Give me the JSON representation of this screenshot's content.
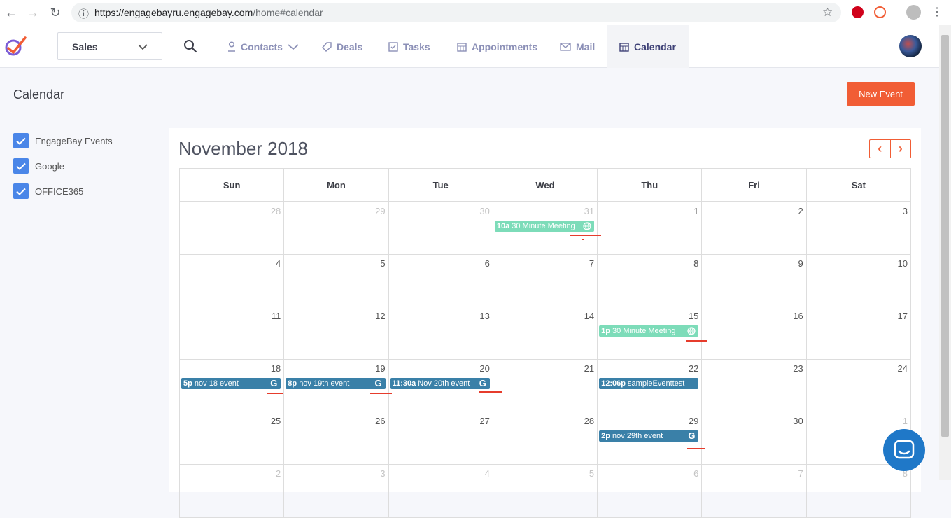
{
  "browser": {
    "url_host": "https://engagebayru.engagebay.com",
    "url_path": "/home#calendar"
  },
  "appnav": {
    "pipeline_select": "Sales",
    "items": [
      {
        "label": "Contacts"
      },
      {
        "label": "Deals"
      },
      {
        "label": "Tasks"
      },
      {
        "label": "Appointments"
      },
      {
        "label": "Mail"
      },
      {
        "label": "Calendar"
      }
    ]
  },
  "page": {
    "title": "Calendar",
    "new_event_label": "New Event"
  },
  "filters": [
    {
      "label": "EngageBay Events",
      "checked": true
    },
    {
      "label": "Google",
      "checked": true
    },
    {
      "label": "OFFICE365",
      "checked": true
    }
  ],
  "calendar": {
    "month_title": "November 2018",
    "prev_icon": "chevron-left-icon",
    "next_icon": "chevron-right-icon",
    "weekdays": [
      "Sun",
      "Mon",
      "Tue",
      "Wed",
      "Thu",
      "Fri",
      "Sat"
    ],
    "weeks": [
      [
        "28",
        "29",
        "30",
        "31",
        "1",
        "2",
        "3"
      ],
      [
        "4",
        "5",
        "6",
        "7",
        "8",
        "9",
        "10"
      ],
      [
        "11",
        "12",
        "13",
        "14",
        "15",
        "16",
        "17"
      ],
      [
        "18",
        "19",
        "20",
        "21",
        "22",
        "23",
        "24"
      ],
      [
        "25",
        "26",
        "27",
        "28",
        "29",
        "30",
        "1"
      ],
      [
        "2",
        "3",
        "4",
        "5",
        "6",
        "7",
        "8"
      ]
    ],
    "events": [
      {
        "time": "10a",
        "title": "30 Minute Meeting",
        "color": "#7ddcb9",
        "icon": "globe-icon"
      },
      {
        "time": "1p",
        "title": "30 Minute Meeting",
        "color": "#7ddcb9",
        "icon": "globe-icon"
      },
      {
        "time": "5p",
        "title": "nov 18 event",
        "color": "#3a80a8",
        "icon": "google-icon"
      },
      {
        "time": "8p",
        "title": "nov 19th event",
        "color": "#3a80a8",
        "icon": "google-icon"
      },
      {
        "time": "11:30a",
        "title": "Nov 20th event",
        "color": "#3a80a8",
        "icon": "google-icon"
      },
      {
        "time": "12:06p",
        "title": "sampleEventtest",
        "color": "#3a80a8",
        "icon": ""
      },
      {
        "time": "2p",
        "title": "nov 29th event",
        "color": "#3a80a8",
        "icon": "google-icon"
      }
    ]
  },
  "colors": {
    "accent": "#f15d35",
    "checkbox": "#4a86e8",
    "event_green": "#7ddcb9",
    "event_blue": "#3a80a8",
    "annotation_red": "#e63c2c",
    "chat": "#1f78c8"
  }
}
